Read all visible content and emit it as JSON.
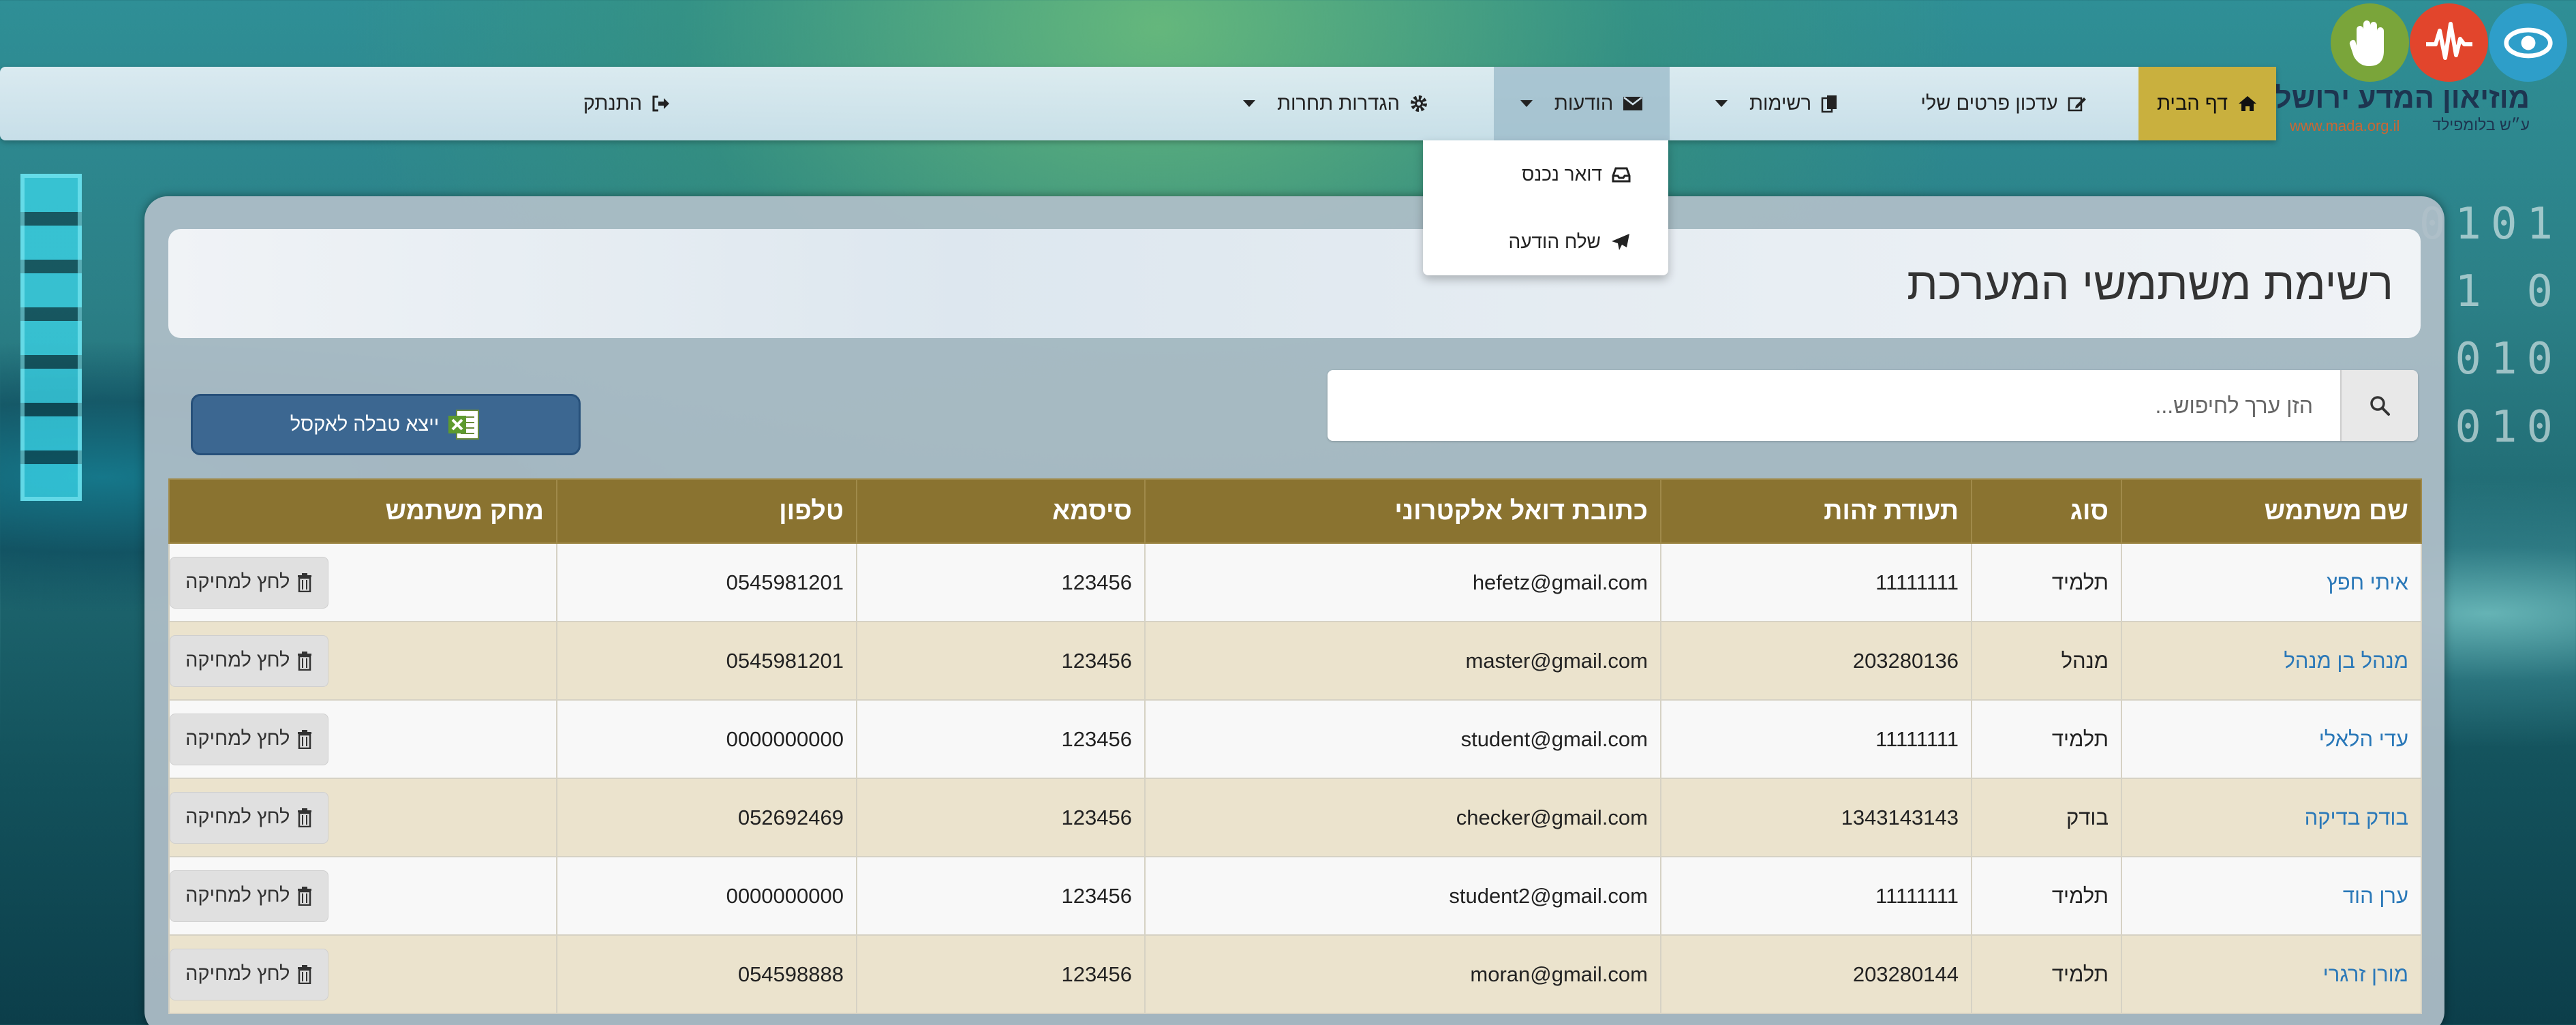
{
  "logo": {
    "title": "מוזיאון המדע ירושלים",
    "subtitle": "ע״ש בלומפילד",
    "url": "www.mada.org.il",
    "circles": [
      {
        "icon": "eye-icon",
        "color": "#2e9ec9"
      },
      {
        "icon": "pulse-icon",
        "color": "#e2452c"
      },
      {
        "icon": "hand-icon",
        "color": "#7aa53a"
      }
    ]
  },
  "nav": {
    "home": "דף הבית",
    "update_details": "עדכון פרטים שלי",
    "lists": "רשימות",
    "messages": "הודעות",
    "competition_settings": "הגדרות תחרות",
    "logout": "התנתק"
  },
  "messages_dropdown": {
    "inbox": "דואר נכנס",
    "send_message": "שלח הודעה"
  },
  "page": {
    "title": "רשימת משתמשי המערכת",
    "search_placeholder": "הזן ערך לחיפוש...",
    "export_button": "ייצא טבלה לאקסל"
  },
  "table": {
    "headers": {
      "username": "שם משתמש",
      "type": "סוג",
      "id": "תעודת זהות",
      "email": "כתובת דואל אלקטרוני",
      "password": "סיסמא",
      "phone": "טלפון",
      "delete": "מחק משתמש"
    },
    "delete_label": "לחץ למחיקה",
    "rows": [
      {
        "name": "איתי חפץ",
        "type": "תלמיד",
        "id": "11111111",
        "email": "hefetz@gmail.com",
        "password": "123456",
        "phone": "0545981201"
      },
      {
        "name": "מנהל בן מנהל",
        "type": "מנהל",
        "id": "203280136",
        "email": "master@gmail.com",
        "password": "123456",
        "phone": "0545981201"
      },
      {
        "name": "עדי הלאלי",
        "type": "תלמיד",
        "id": "11111111",
        "email": "student@gmail.com",
        "password": "123456",
        "phone": "0000000000"
      },
      {
        "name": "בודק בדיקה",
        "type": "בודק",
        "id": "1343143143",
        "email": "checker@gmail.com",
        "password": "123456",
        "phone": "052692469"
      },
      {
        "name": "ערן הוד",
        "type": "תלמיד",
        "id": "11111111",
        "email": "student2@gmail.com",
        "password": "123456",
        "phone": "0000000000"
      },
      {
        "name": "מורן זרגרי",
        "type": "תלמיד",
        "id": "203280144",
        "email": "moran@gmail.com",
        "password": "123456",
        "phone": "054598888"
      }
    ]
  },
  "colors": {
    "home_active": "#c9b03e",
    "table_header": "#8a7330",
    "row_alt": "#ebe3cd",
    "link": "#2a78b8",
    "export_button": "#3c6791"
  }
}
